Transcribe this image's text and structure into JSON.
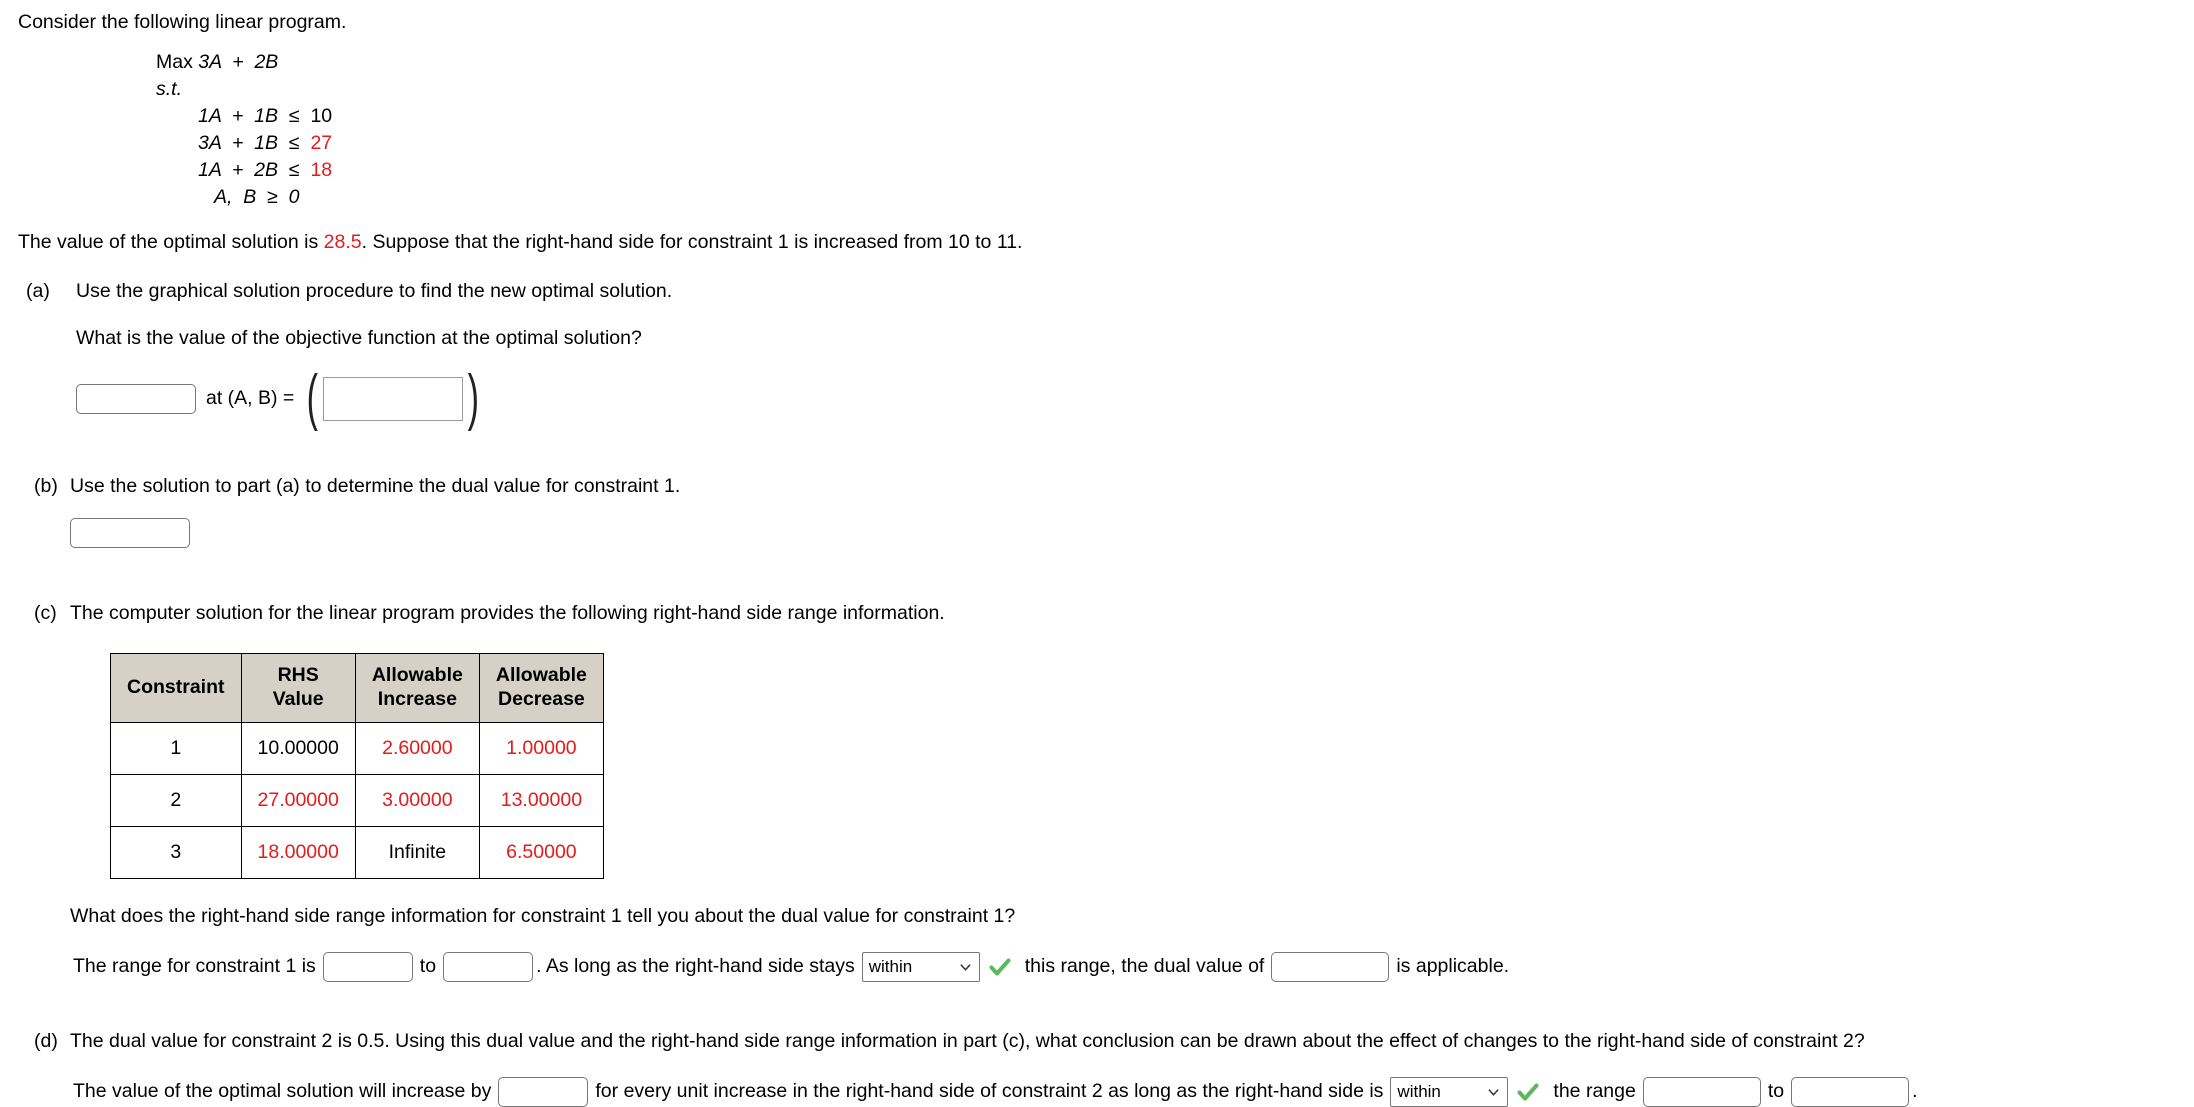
{
  "intro": "Consider the following linear program.",
  "lp": {
    "objective_prefix": "Max",
    "objective": "3A  +  2B",
    "st": "s.t.",
    "constraints": [
      {
        "lhs": "1A  +  1B",
        "rel": "≤",
        "rhs": "10",
        "rhs_red": false
      },
      {
        "lhs": "3A  +  1B",
        "rel": "≤",
        "rhs": "27",
        "rhs_red": true
      },
      {
        "lhs": "1A  +  2B",
        "rel": "≤",
        "rhs": "18",
        "rhs_red": true
      }
    ],
    "nonnegativity": "A,  B  ≥  0"
  },
  "statement": {
    "pre": "The value of the optimal solution is ",
    "optimal_value": "28.5",
    "post": ". Suppose that the right-hand side for constraint 1 is increased from 10 to 11."
  },
  "parts": {
    "a": {
      "label": "(a)",
      "prompt": "Use the graphical solution procedure to find the new optimal solution.",
      "question": "What is the value of the objective function at the optimal solution?",
      "objective_value_input": "",
      "at_text": "at (A, B) =",
      "point_input": "",
      "open_paren": "(",
      "close_paren": ")"
    },
    "b": {
      "label": "(b)",
      "prompt": "Use the solution to part (a) to determine the dual value for constraint 1.",
      "dual_value_input": ""
    },
    "c": {
      "label": "(c)",
      "prompt": "The computer solution for the linear program provides the following right-hand side range information.",
      "table": {
        "headers": [
          "Constraint",
          "RHS\nValue",
          "Allowable\nIncrease",
          "Allowable\nDecrease"
        ],
        "headers_line1": [
          "Constraint",
          "RHS",
          "Allowable",
          "Allowable"
        ],
        "headers_line2": [
          "",
          "Value",
          "Increase",
          "Decrease"
        ],
        "rows": [
          {
            "constraint": "1",
            "rhs_value": "10.00000",
            "rhs_value_red": false,
            "increase": "2.60000",
            "increase_red": true,
            "decrease": "1.00000",
            "decrease_red": true
          },
          {
            "constraint": "2",
            "rhs_value": "27.00000",
            "rhs_value_red": true,
            "increase": "3.00000",
            "increase_red": true,
            "decrease": "13.00000",
            "decrease_red": true
          },
          {
            "constraint": "3",
            "rhs_value": "18.00000",
            "rhs_value_red": true,
            "increase": "Infinite",
            "increase_red": false,
            "decrease": "6.50000",
            "decrease_red": true
          }
        ]
      },
      "question": "What does the right-hand side range information for constraint 1 tell you about the dual value for constraint 1?",
      "sentence": {
        "t1": "The range for constraint 1 is",
        "range_low_input": "",
        "t2": "to",
        "range_high_input": "",
        "t3": ". As long as the right-hand side stays",
        "select_value": "within",
        "t4": "this range, the dual value of",
        "dual_value_input": "",
        "t5": "is applicable."
      }
    },
    "d": {
      "label": "(d)",
      "prompt": "The dual value for constraint 2 is 0.5. Using this dual value and the right-hand side range information in part (c), what conclusion can be drawn about the effect of changes to the right-hand side of constraint 2?",
      "sentence": {
        "t1": "The value of the optimal solution will increase by",
        "increase_input": "",
        "t2": "for every unit increase in the right-hand side of constraint 2 as long as the right-hand side is",
        "select_value": "within",
        "t3": "the range",
        "range_low_input": "",
        "t4": "to",
        "range_high_input": "",
        "t5": "."
      }
    }
  },
  "colors": {
    "highlight_red": "#e21b1b",
    "table_header_bg": "#d5d1c7",
    "check_green": "#5cb85c",
    "input_border": "#767676"
  },
  "icons": {
    "check": "check-icon",
    "chevron": "chevron-down-icon"
  }
}
